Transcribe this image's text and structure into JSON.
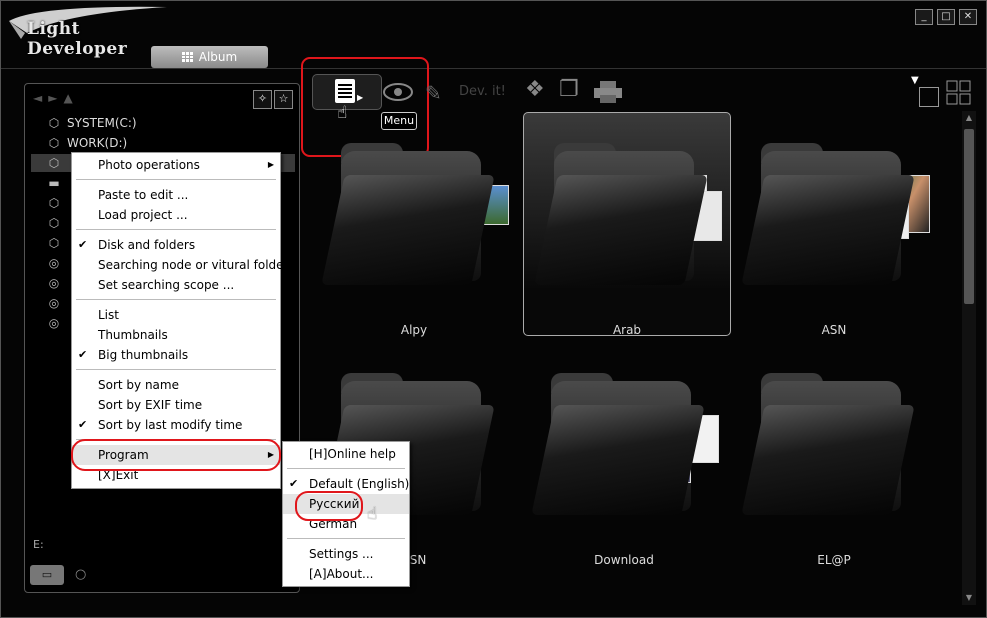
{
  "app": {
    "name": "Light Developer"
  },
  "window_buttons": [
    "_",
    "□",
    "✕"
  ],
  "album_tab": {
    "label": "Album",
    "icon": "grid-icon"
  },
  "toolbar": {
    "menu_tooltip": "Menu",
    "devit_label": "Dev. it!"
  },
  "tree": {
    "items": [
      {
        "label": "SYSTEM(C:)",
        "icon": "disk-icon"
      },
      {
        "label": "WORK(D:)",
        "icon": "disk-icon"
      },
      {
        "label": "",
        "icon": "disk-icon"
      },
      {
        "label": "",
        "icon": "folder-icon"
      },
      {
        "label": "",
        "icon": "disk-icon"
      },
      {
        "label": "",
        "icon": "disk-icon"
      },
      {
        "label": "",
        "icon": "disk-icon"
      },
      {
        "label": "",
        "icon": "cd-icon"
      },
      {
        "label": "",
        "icon": "cd-icon"
      },
      {
        "label": "",
        "icon": "cd-icon"
      },
      {
        "label": "",
        "icon": "cd-icon"
      }
    ],
    "status": "E:"
  },
  "context_menu": {
    "items": [
      {
        "label": "Photo operations",
        "submenu": true
      },
      {
        "label": "Paste to edit ..."
      },
      {
        "label": "Load project ..."
      },
      {
        "label": "Disk and folders",
        "checked": true
      },
      {
        "label": "Searching node or vitural folder"
      },
      {
        "label": "Set searching scope ..."
      },
      {
        "label": "List"
      },
      {
        "label": "Thumbnails"
      },
      {
        "label": "Big thumbnails",
        "checked": true
      },
      {
        "label": "Sort by name"
      },
      {
        "label": "Sort by EXIF time"
      },
      {
        "label": "Sort by last modify time",
        "checked": true
      },
      {
        "label": "Program",
        "submenu": true
      },
      {
        "label": "[X]Exit"
      }
    ]
  },
  "program_submenu": {
    "items": [
      {
        "label": "[H]Online help"
      },
      {
        "label": "Default (English)",
        "checked": true
      },
      {
        "label": "Русский"
      },
      {
        "label": "German"
      },
      {
        "label": "Settings ..."
      },
      {
        "label": "[A]About..."
      }
    ]
  },
  "folders": [
    {
      "label": "Alpy"
    },
    {
      "label": "Arab"
    },
    {
      "label": "ASN"
    },
    {
      "label": "ASN"
    },
    {
      "label": "Download"
    },
    {
      "label": "EL@P"
    }
  ],
  "colors": {
    "highlight": "#e0161b",
    "background": "#000000",
    "menu_bg": "#ffffff"
  }
}
